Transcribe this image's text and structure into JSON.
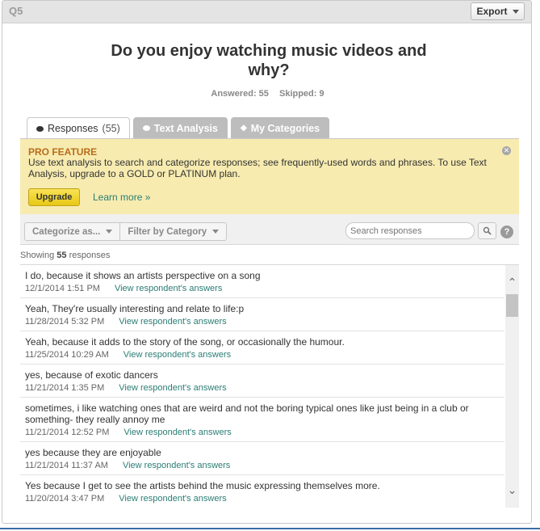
{
  "question": {
    "number": "Q5",
    "export_label": "Export",
    "title_line1": "Do you enjoy watching music videos and",
    "title_line2": "why?",
    "answered": "Answered: 55",
    "skipped": "Skipped: 9"
  },
  "tabs": [
    {
      "label": "Responses",
      "count": "(55)",
      "icon": "speech-bubble-icon"
    },
    {
      "label": "Text Analysis",
      "icon": "cloud-icon"
    },
    {
      "label": "My Categories",
      "icon": "tag-icon"
    }
  ],
  "pro_feature": {
    "title": "PRO FEATURE",
    "text": "Use text analysis to search and categorize responses; see frequently-used words and phrases. To use Text Analysis, upgrade to a GOLD or PLATINUM plan.",
    "upgrade_label": "Upgrade",
    "learn_more_label": "Learn more »"
  },
  "toolbar": {
    "categorize_label": "Categorize as...",
    "filter_label": "Filter by Category",
    "search_placeholder": "Search responses"
  },
  "showing": {
    "prefix": "Showing",
    "count": "55",
    "suffix": "responses"
  },
  "responses": [
    {
      "text": "I do, because it shows an artists perspective on a song",
      "date": "12/1/2014 1:51 PM",
      "link": "View respondent's answers"
    },
    {
      "text": "Yeah, They're usually interesting and relate to life:p",
      "date": "11/28/2014 5:32 PM",
      "link": "View respondent's answers"
    },
    {
      "text": "Yeah, because it adds to the story of the song, or occasionally the humour.",
      "date": "11/25/2014 10:29 AM",
      "link": "View respondent's answers"
    },
    {
      "text": "yes, because of exotic dancers",
      "date": "11/21/2014 1:35 PM",
      "link": "View respondent's answers"
    },
    {
      "text": "sometimes, i like watching ones that are weird and not the boring typical ones like just being in a club or something- they really annoy me",
      "date": "11/21/2014 12:52 PM",
      "link": "View respondent's answers"
    },
    {
      "text": "yes because they are enjoyable",
      "date": "11/21/2014 11:37 AM",
      "link": "View respondent's answers"
    },
    {
      "text": "Yes because I get to see the artists behind the music expressing themselves more.",
      "date": "11/20/2014 3:47 PM",
      "link": "View respondent's answers"
    }
  ],
  "colors": {
    "accent_link": "#2b7d74",
    "pro_bg": "#f7ebb0",
    "pro_title": "#b86d1a",
    "upgrade": "#e8c814"
  }
}
